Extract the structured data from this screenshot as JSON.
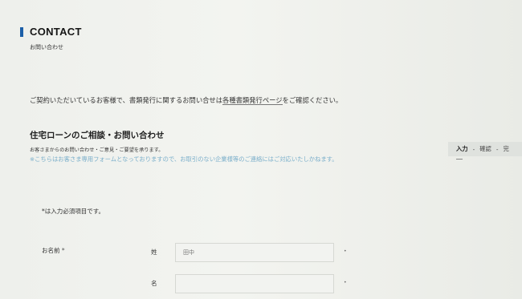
{
  "header": {
    "title": "CONTACT",
    "subtitle": "お問い合わせ"
  },
  "intro": {
    "prefix": "ご契約いただいているお客様で、書類発行に関するお問い合せは",
    "link_label": "各種書類発行ページ",
    "suffix": "をご確認ください。"
  },
  "section": {
    "title": "住宅ローンのご相談・お問い合わせ",
    "description": "お客さまからのお問い合わせ・ご意見・ご要望を承ります。",
    "notice": "※こちらはお客さま専用フォームとなっておりますので、お取引のない企業様等のご連絡にはご対応いたしかねます。"
  },
  "steps": {
    "items": [
      "入力",
      "確認",
      "完"
    ],
    "separator": "-",
    "active_index": 0
  },
  "form": {
    "required_note": "*は入力必須項目です。",
    "name_label": "お名前",
    "required_mark": "*",
    "last_name_label": "姓",
    "last_name_placeholder": "田中",
    "first_name_label": "名",
    "first_name_placeholder": "",
    "field_mark": "•"
  },
  "colors": {
    "accent_bar": "#1c5fa8",
    "notice_text": "#79aeca",
    "background": "#eef0ec"
  }
}
